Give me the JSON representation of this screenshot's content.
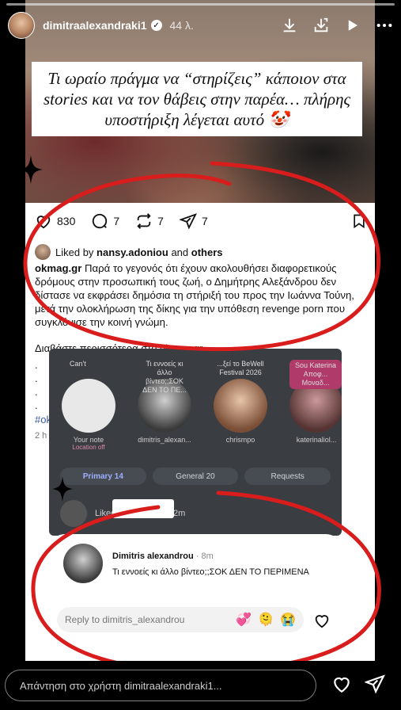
{
  "story": {
    "username": "dimitraalexandraki1",
    "time": "44 λ.",
    "quote": "Τι ωραίο πράγμα να “στηρίζεις” κάποιον στα stories και να τον θάβεις στην παρέα… πλήρης υποστήριξη λέγεται αυτό 🤡"
  },
  "post": {
    "likes": "830",
    "comments": "7",
    "reposts": "7",
    "shares": "7",
    "liked_by_prefix": "Liked by",
    "liked_by_user": "nansy.adoniou",
    "liked_by_and": "and",
    "liked_by_others": "others",
    "caption_user": "okmag.gr",
    "caption_text": "Παρά το γεγονός ότι έχουν ακολουθήσει διαφορετικούς δρόμους στην προσωπική τους ζωή, ο Δημήτρης Αλεξάνδρου δεν δίστασε να εκφράσει δημόσια τη στήριξή του προς την Ιωάννα Τούνη, μετά την ολοκλήρωση της δίκης για την υπόθεση revenge porn που συγκλόνισε την κοινή γνώμη.",
    "more_line": "Διαβάστε περισσότερα στο okmag.gr",
    "dots": ".\n.\n.\n.",
    "hashtag": "#ok",
    "ago": "2 h"
  },
  "inbox": {
    "notes": [
      {
        "bubble": "Can't",
        "name": "Your note",
        "sub": "Location off"
      },
      {
        "bubble": "Τι εννοείς κι άλλο βίντεο;;ΣΟΚ ΔΕΝ ΤΟ ΠΕ...",
        "name": "dimitris_alexan..."
      },
      {
        "bubble": "...ξεί το BeWell Festival 2026",
        "name": "chrismpo"
      },
      {
        "bubble": "Sou Katerina Αποφ... Μοναδ...",
        "name": "katerinaliol..."
      }
    ],
    "tabs": [
      {
        "label": "Primary",
        "count": "14"
      },
      {
        "label": "General",
        "count": "20"
      },
      {
        "label": "Requests",
        "count": ""
      }
    ],
    "row_text": "Liked a message · 12m"
  },
  "reply": {
    "name": "Dimitris alexandrou",
    "time": "· 8m",
    "message": "Τι εννοείς κι άλλο βίντεο;;ΣΟΚ ΔΕΝ ΤΟ ΠΕΡΙΜΕΝΑ",
    "placeholder": "Reply to dimitris_alexandrou",
    "emojis": [
      "💞",
      "🫠",
      "😭"
    ]
  },
  "bottom": {
    "placeholder": "Απάντηση στο χρήστη dimitraalexandraki1..."
  }
}
